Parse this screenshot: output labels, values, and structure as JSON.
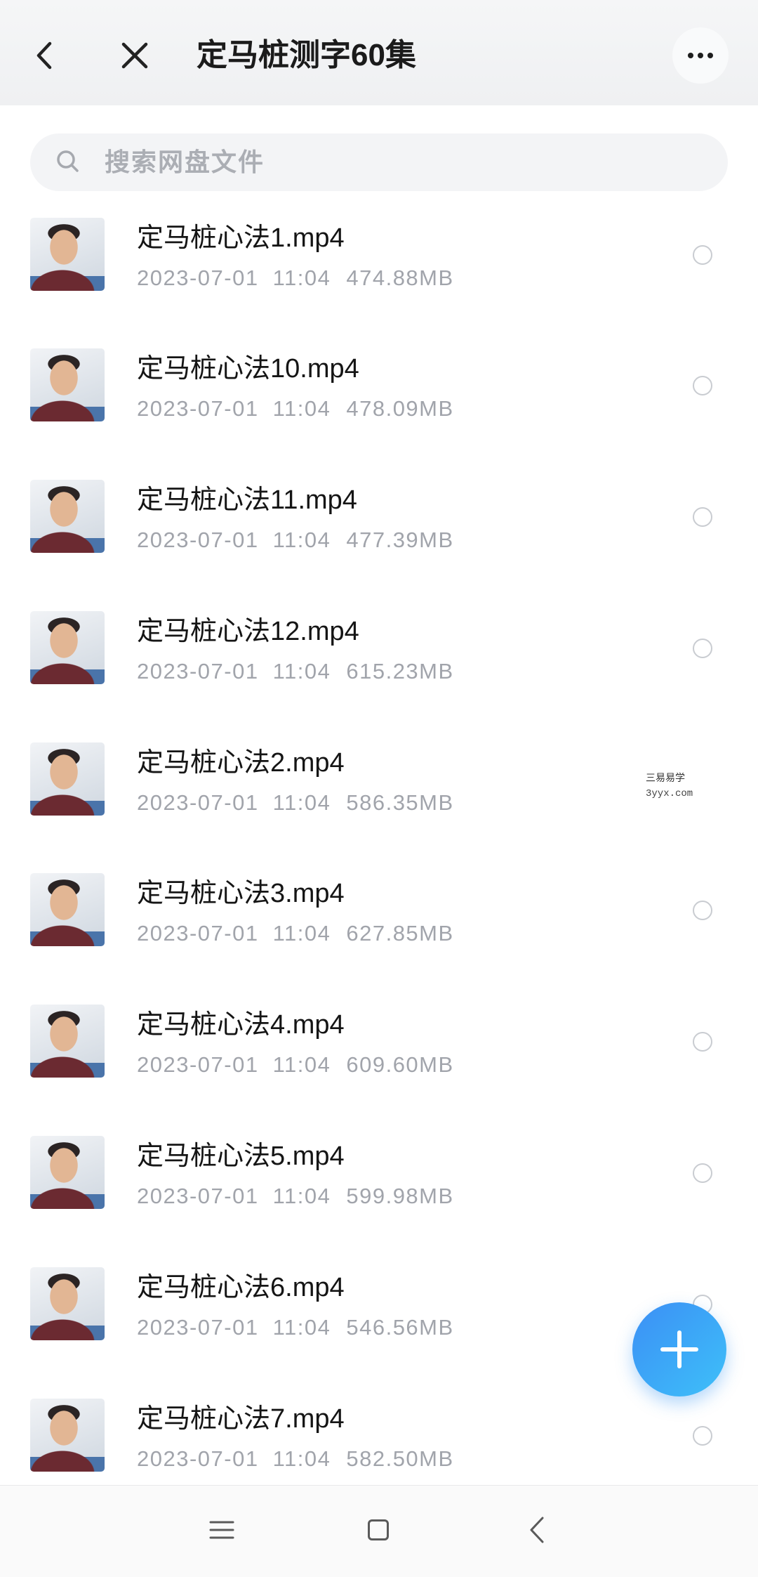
{
  "header": {
    "title": "定马桩测字60集",
    "back_icon": "chevron-left-icon",
    "close_icon": "close-icon",
    "more_icon": "more-horizontal-icon"
  },
  "search": {
    "placeholder": "搜索网盘文件",
    "value": "",
    "icon": "search-icon"
  },
  "files": [
    {
      "name": "定马桩心法1.mp4",
      "date": "2023-07-01",
      "time": "11:04",
      "size": "474.88MB"
    },
    {
      "name": "定马桩心法10.mp4",
      "date": "2023-07-01",
      "time": "11:04",
      "size": "478.09MB"
    },
    {
      "name": "定马桩心法11.mp4",
      "date": "2023-07-01",
      "time": "11:04",
      "size": "477.39MB"
    },
    {
      "name": "定马桩心法12.mp4",
      "date": "2023-07-01",
      "time": "11:04",
      "size": "615.23MB"
    },
    {
      "name": "定马桩心法2.mp4",
      "date": "2023-07-01",
      "time": "11:04",
      "size": "586.35MB"
    },
    {
      "name": "定马桩心法3.mp4",
      "date": "2023-07-01",
      "time": "11:04",
      "size": "627.85MB"
    },
    {
      "name": "定马桩心法4.mp4",
      "date": "2023-07-01",
      "time": "11:04",
      "size": "609.60MB"
    },
    {
      "name": "定马桩心法5.mp4",
      "date": "2023-07-01",
      "time": "11:04",
      "size": "599.98MB"
    },
    {
      "name": "定马桩心法6.mp4",
      "date": "2023-07-01",
      "time": "11:04",
      "size": "546.56MB"
    },
    {
      "name": "定马桩心法7.mp4",
      "date": "2023-07-01",
      "time": "11:04",
      "size": "582.50MB"
    }
  ],
  "watermark": {
    "line1": "三易易学",
    "line2": "3yyx.com"
  },
  "fab": {
    "icon": "plus-icon"
  },
  "nav": {
    "menu_icon": "menu-icon",
    "home_icon": "square-home-icon",
    "back_icon": "back-chevron-icon"
  },
  "colors": {
    "header_bg": "#f1f2f4",
    "search_bg": "#f3f4f6",
    "meta_text": "#a1a4ab",
    "radio_border": "#c9ccd1",
    "fab_start": "#3b8ff5",
    "fab_end": "#3ec0f9"
  }
}
